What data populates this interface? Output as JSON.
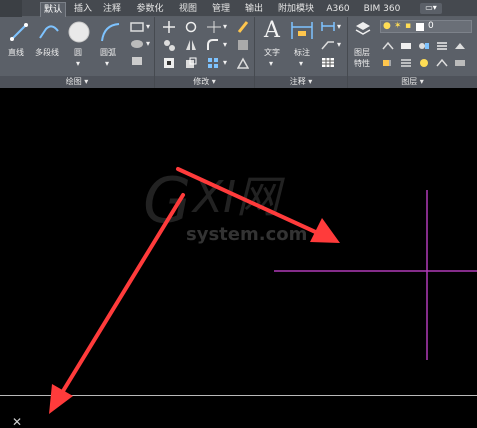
{
  "tabs": [
    {
      "label": "默认",
      "active": true
    },
    {
      "label": "插入",
      "active": false
    },
    {
      "label": "注释",
      "active": false
    },
    {
      "label": "参数化",
      "active": false
    },
    {
      "label": "视图",
      "active": false
    },
    {
      "label": "管理",
      "active": false
    },
    {
      "label": "输出",
      "active": false
    },
    {
      "label": "附加模块",
      "active": false
    },
    {
      "label": "A360",
      "active": false
    },
    {
      "label": "BIM 360",
      "active": false
    }
  ],
  "ribbon": {
    "draw": {
      "title": "绘图",
      "tools": [
        "直线",
        "多段线",
        "圆",
        "圆弧"
      ]
    },
    "modify": {
      "title": "修改"
    },
    "annotation": {
      "title": "注释",
      "tools": [
        "文字",
        "标注"
      ]
    },
    "layers": {
      "title": "图层",
      "tool_line1": "图层",
      "tool_line2": "特性",
      "layer_value": "0"
    }
  },
  "watermark": {
    "logo_letters": "G X I 网",
    "site": "system.com"
  },
  "colors": {
    "ribbon_bg": "#5b6068",
    "tab_bg": "#45494f",
    "canvas_bg": "#000000",
    "crosshair": "#b03ab8",
    "arrow": "#ff3b3b"
  }
}
